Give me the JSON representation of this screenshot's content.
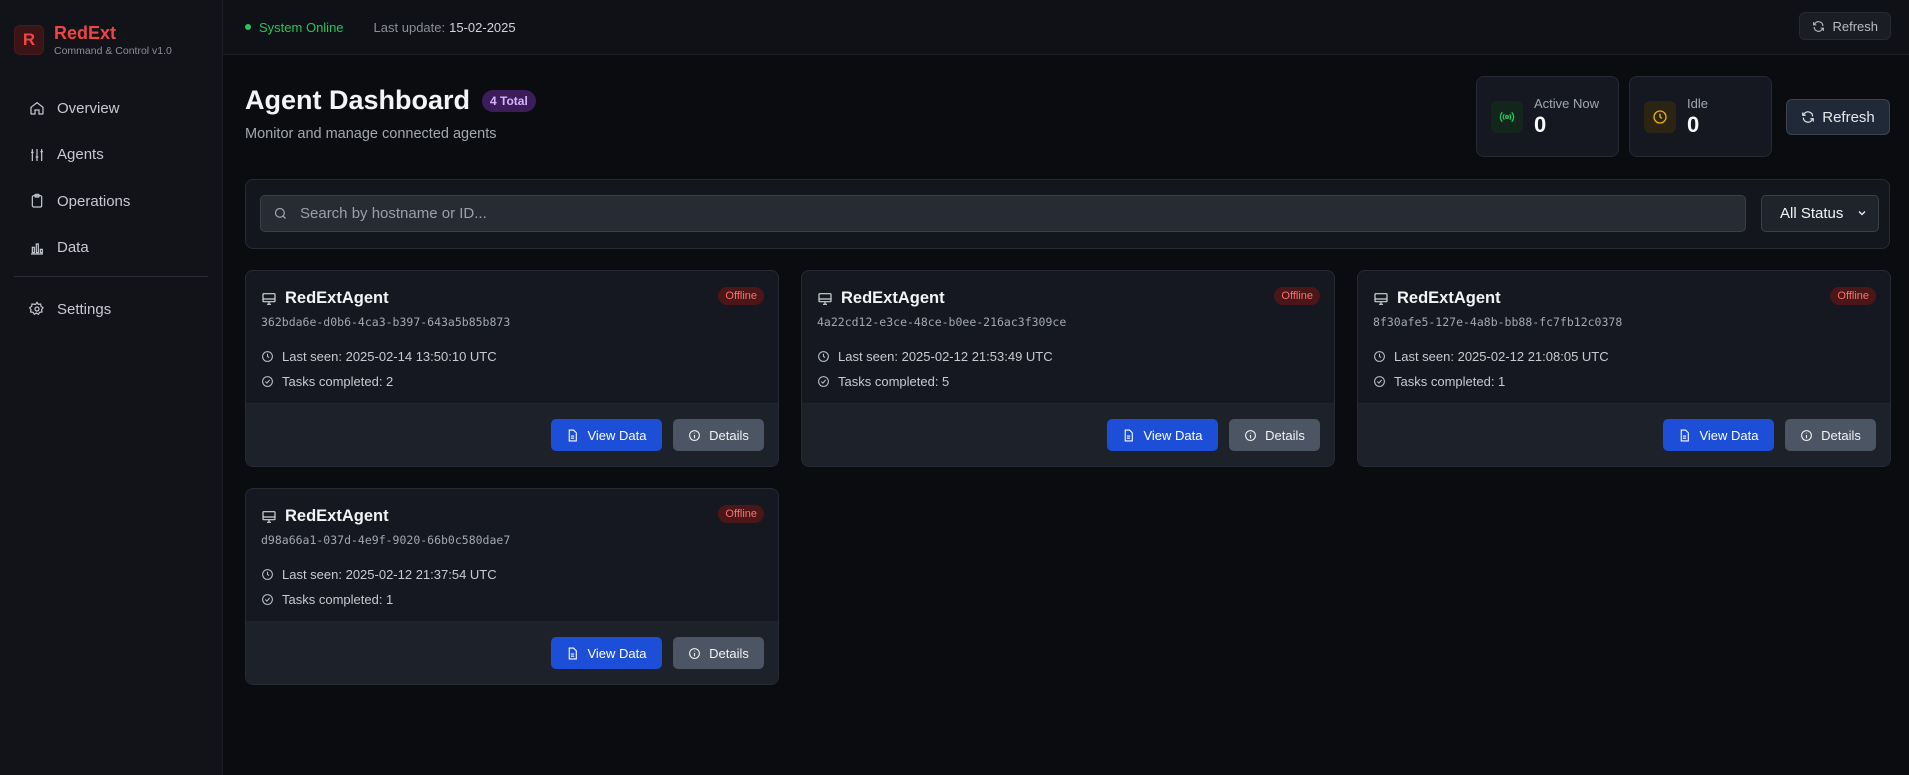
{
  "brand": {
    "logo_letter": "R",
    "name": "RedExt",
    "subtitle": "Command & Control v1.0"
  },
  "nav": {
    "items": [
      {
        "label": "Overview",
        "icon": "home-icon"
      },
      {
        "label": "Agents",
        "icon": "sliders-icon"
      },
      {
        "label": "Operations",
        "icon": "clipboard-icon"
      },
      {
        "label": "Data",
        "icon": "bar-chart-icon"
      }
    ],
    "settings": {
      "label": "Settings",
      "icon": "gear-icon"
    }
  },
  "topbar": {
    "status": "System Online",
    "last_update_label": "Last update:",
    "last_update_value": "15-02-2025",
    "refresh_label": "Refresh"
  },
  "header": {
    "title": "Agent Dashboard",
    "total_badge": "4 Total",
    "subtitle": "Monitor and manage connected agents",
    "refresh_label": "Refresh"
  },
  "stats": {
    "active": {
      "label": "Active Now",
      "value": "0",
      "color": "#22c55e"
    },
    "idle": {
      "label": "Idle",
      "value": "0",
      "color": "#eab308"
    }
  },
  "filters": {
    "search_placeholder": "Search by hostname or ID...",
    "status_selected": "All Status"
  },
  "agents": [
    {
      "name": "RedExtAgent",
      "id": "362bda6e-d0b6-4ca3-b397-643a5b85b873",
      "status": "Offline",
      "last_seen": "Last seen: 2025-02-14 13:50:10 UTC",
      "tasks": "Tasks completed: 2",
      "view_label": "View Data",
      "details_label": "Details"
    },
    {
      "name": "RedExtAgent",
      "id": "4a22cd12-e3ce-48ce-b0ee-216ac3f309ce",
      "status": "Offline",
      "last_seen": "Last seen: 2025-02-12 21:53:49 UTC",
      "tasks": "Tasks completed: 5",
      "view_label": "View Data",
      "details_label": "Details"
    },
    {
      "name": "RedExtAgent",
      "id": "8f30afe5-127e-4a8b-bb88-fc7fb12c0378",
      "status": "Offline",
      "last_seen": "Last seen: 2025-02-12 21:08:05 UTC",
      "tasks": "Tasks completed: 1",
      "view_label": "View Data",
      "details_label": "Details"
    },
    {
      "name": "RedExtAgent",
      "id": "d98a66a1-037d-4e9f-9020-66b0c580dae7",
      "status": "Offline",
      "last_seen": "Last seen: 2025-02-12 21:37:54 UTC",
      "tasks": "Tasks completed: 1",
      "view_label": "View Data",
      "details_label": "Details"
    }
  ]
}
